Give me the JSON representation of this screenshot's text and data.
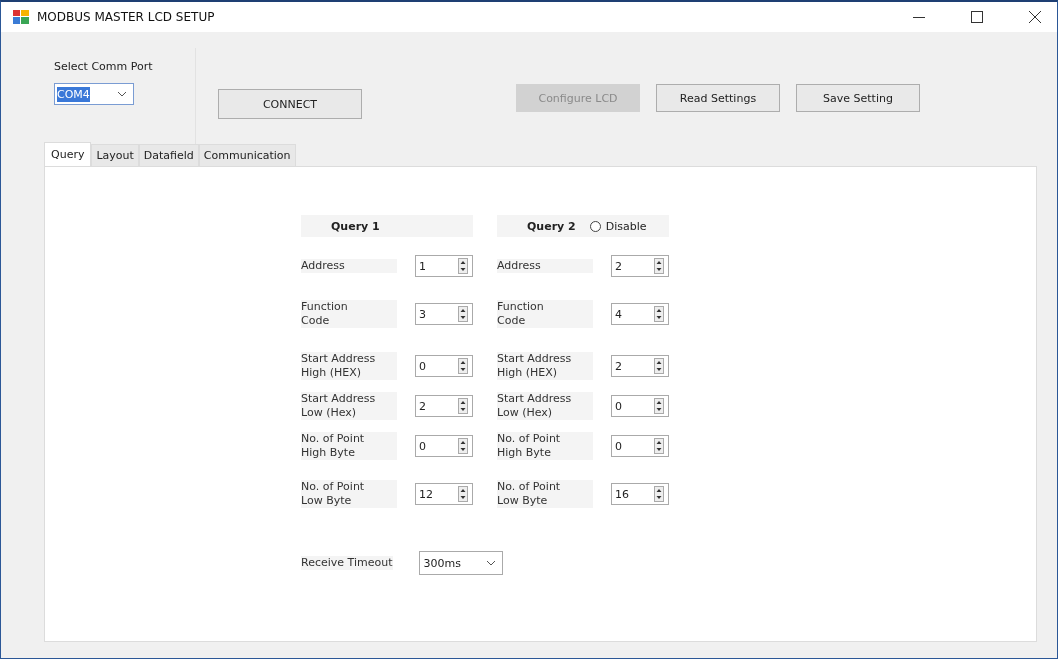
{
  "window": {
    "title": "MODBUS MASTER LCD SETUP"
  },
  "comm_port": {
    "label": "Select Comm Port",
    "value": "COM4"
  },
  "buttons": [
    {
      "label": "CONNECT",
      "disabled": false
    },
    {
      "label": "Configure LCD",
      "disabled": true
    },
    {
      "label": "Read Settings",
      "disabled": false
    },
    {
      "label": "Save Setting",
      "disabled": false
    }
  ],
  "tabs": [
    {
      "label": "Query",
      "selected": true
    },
    {
      "label": "Layout",
      "selected": false
    },
    {
      "label": "Datafield",
      "selected": false
    },
    {
      "label": "Communication",
      "selected": false
    }
  ],
  "queries": [
    {
      "title": "Query 1",
      "fields": [
        {
          "label": "Address",
          "value": "1"
        },
        {
          "label": "Function\nCode",
          "value": "3"
        },
        {
          "label": "Start Address\nHigh (HEX)",
          "value": "0"
        },
        {
          "label": "Start Address\nLow (Hex)",
          "value": "2"
        },
        {
          "label": "No. of Point\nHigh Byte",
          "value": "0"
        },
        {
          "label": "No. of Point\nLow Byte",
          "value": "12"
        }
      ]
    },
    {
      "title": "Query 2",
      "disable": {
        "label": "Disable",
        "checked": false
      },
      "fields": [
        {
          "label": "Address",
          "value": "2"
        },
        {
          "label": "Function\nCode",
          "value": "4"
        },
        {
          "label": "Start Address\nHigh (HEX)",
          "value": "2"
        },
        {
          "label": "Start Address\nLow (Hex)",
          "value": "0"
        },
        {
          "label": "No. of Point\nHigh Byte",
          "value": "0"
        },
        {
          "label": "No. of Point\nLow Byte",
          "value": "16"
        }
      ]
    }
  ],
  "receive_timeout": {
    "label": "Receive Timeout",
    "value": "300ms"
  }
}
